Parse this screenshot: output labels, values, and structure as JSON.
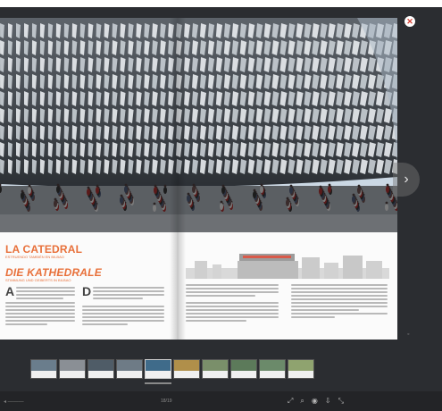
{
  "colors": {
    "background": "#2b2d31",
    "headline": "#e8703a",
    "close": "#d33b2f"
  },
  "spread": {
    "left_page": {
      "headline_1": "LA CATEDRAL",
      "subhead_1": "ESTRUENDO TAMBIÉN EN BILBAO",
      "headline_2": "DIE KATHEDRALE",
      "subhead_2": "STIMMUNG UND GEIBERTS IN BILBAO",
      "dropcap_1": "A",
      "dropcap_2": "D"
    }
  },
  "controls": {
    "close_icon": "close-icon",
    "next_icon": "chevron-right-icon",
    "close_glyph": "✕",
    "next_glyph": "›",
    "small_glyph": "◦"
  },
  "thumbnails": [
    {
      "top": "#6a7d8c",
      "active": false
    },
    {
      "top": "#8a8f95",
      "active": false
    },
    {
      "top": "#4f5c67",
      "active": false
    },
    {
      "top": "#6e7b86",
      "active": false
    },
    {
      "top": "#3f6b8a",
      "active": true
    },
    {
      "top": "#b08f4a",
      "active": false
    },
    {
      "top": "#7a8f6a",
      "active": false
    },
    {
      "top": "#5c7a5a",
      "active": false
    },
    {
      "top": "#6b8a6a",
      "active": false
    },
    {
      "top": "#8fa36f",
      "active": false
    }
  ],
  "toolbar": {
    "left_text": "◂ ———",
    "page_indicator": "18/19",
    "icons": [
      {
        "name": "zoom-icon",
        "glyph": "⤢"
      },
      {
        "name": "search-icon",
        "glyph": "⌕"
      },
      {
        "name": "share-icon",
        "glyph": "◉"
      },
      {
        "name": "download-icon",
        "glyph": "⇩"
      },
      {
        "name": "fullscreen-icon",
        "glyph": "⤡"
      }
    ]
  }
}
